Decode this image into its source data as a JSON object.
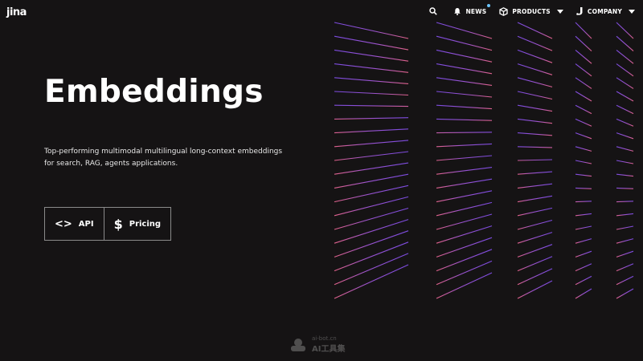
{
  "logo": {
    "text": "jina"
  },
  "nav": {
    "search_icon": "search-icon",
    "items": [
      {
        "label": "NEWS",
        "icon": "bell-icon",
        "has_dot": true
      },
      {
        "label": "PRODUCTS",
        "icon": "cube-icon"
      },
      {
        "label": "COMPANY",
        "icon": "jina-j-icon"
      }
    ]
  },
  "hero": {
    "title": "Embeddings",
    "description": "Top-performing multimodal multilingual long-context embeddings for search, RAG, agents applications.",
    "buttons": [
      {
        "label": "API",
        "icon": "code-icon",
        "glyph": "<>"
      },
      {
        "label": "Pricing",
        "icon": "dollar-icon",
        "glyph": "$"
      }
    ]
  },
  "watermark": {
    "top": "ai-bot.cn",
    "bottom": "AI工具集"
  },
  "colors": {
    "background": "#151314",
    "grid_top": "#7b4be0",
    "grid_bottom": "#e0628a"
  }
}
